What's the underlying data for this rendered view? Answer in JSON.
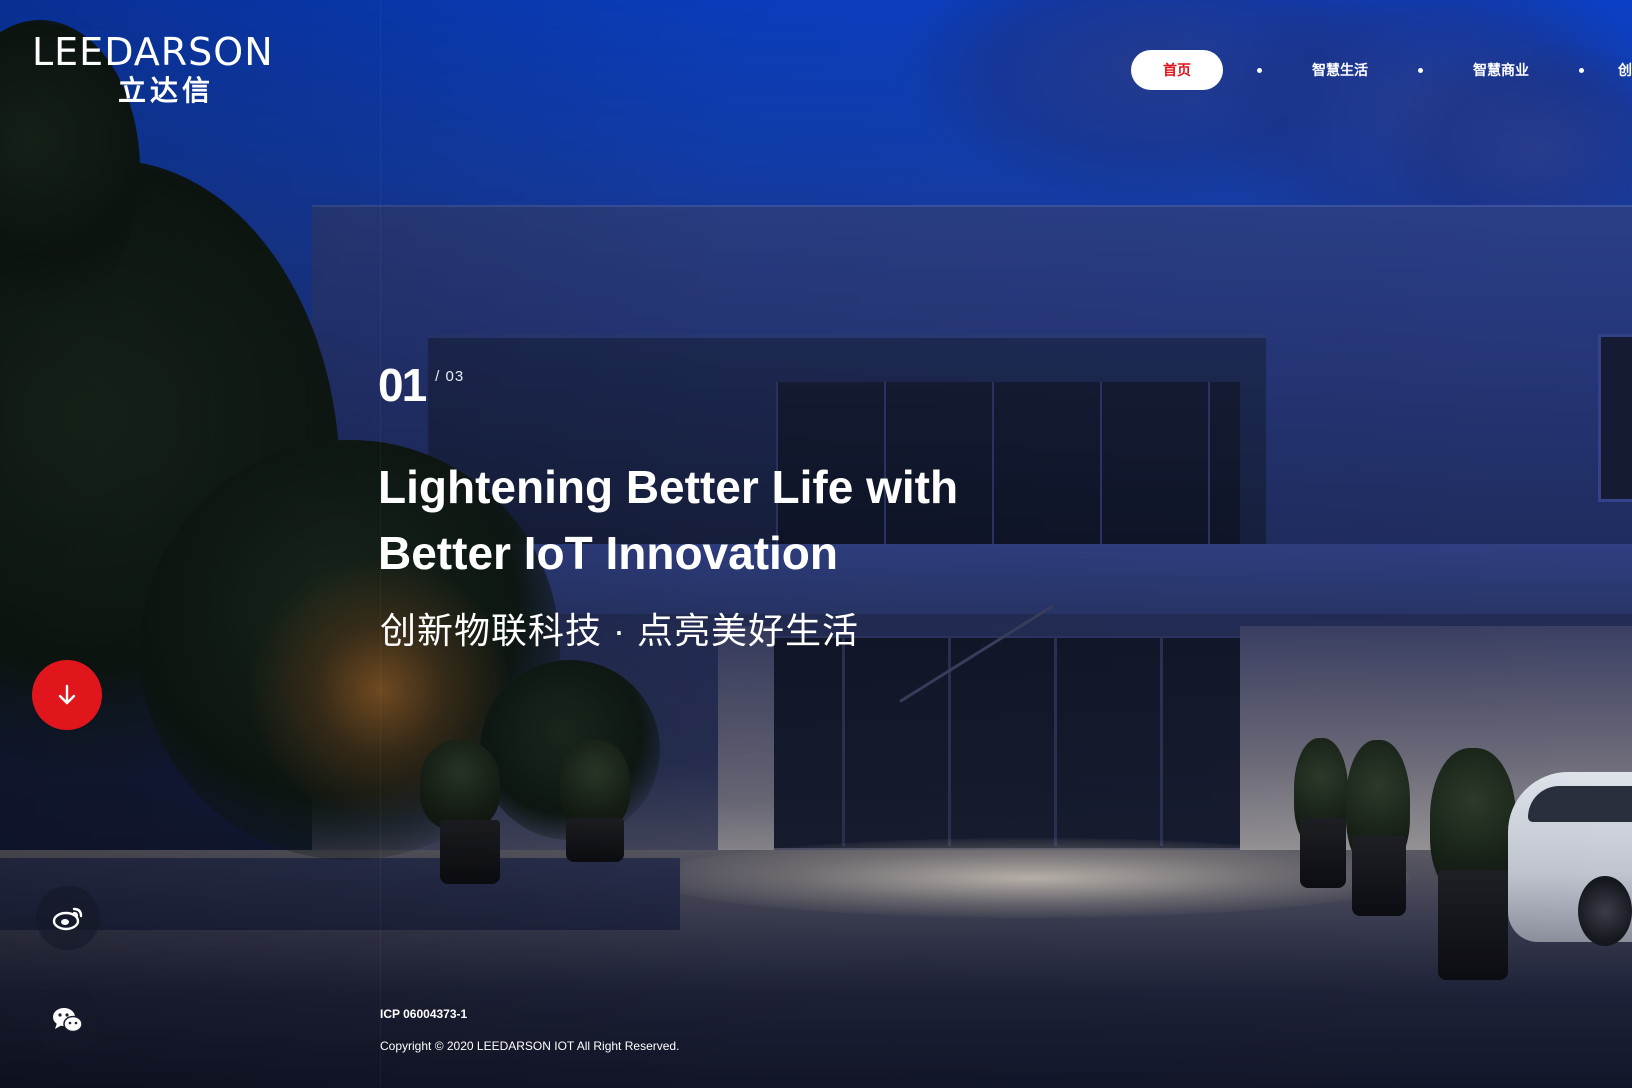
{
  "brand": {
    "name_en": "LEEDARSON",
    "name_cn": "立达信"
  },
  "nav": {
    "items": [
      {
        "label": "首页",
        "active": true
      },
      {
        "label": "智慧生活",
        "active": false
      },
      {
        "label": "智慧商业",
        "active": false
      },
      {
        "label": "创",
        "active": false
      }
    ]
  },
  "hero": {
    "slide_current": "01",
    "slide_total": "/ 03",
    "headline_line1": "Lightening Better Life with",
    "headline_line2": "Better IoT Innovation",
    "subheadline": "创新物联科技 · 点亮美好生活"
  },
  "scroll_button": {
    "icon": "arrow-down-icon"
  },
  "social": {
    "weibo_icon": "weibo-icon",
    "wechat_icon": "wechat-icon"
  },
  "footer": {
    "icp": "ICP 06004373-1",
    "copyright": "Copyright © 2020 LEEDARSON IOT All Right Reserved."
  },
  "colors": {
    "accent": "#e0161c",
    "sky": "#0b3fc4",
    "text": "#ffffff"
  }
}
